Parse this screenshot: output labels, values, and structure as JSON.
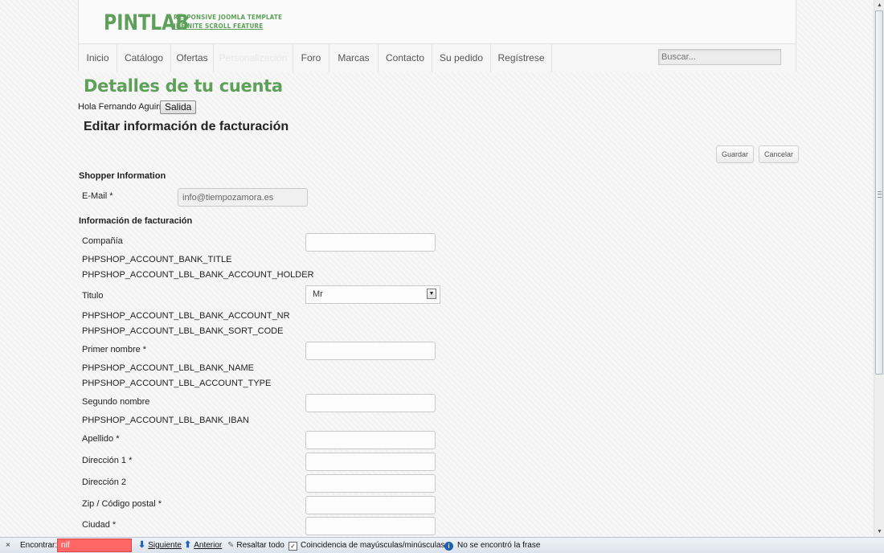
{
  "logo": {
    "text": "PINTLAB",
    "tagline_1": "RESPONSIVE JOOMLA TEMPLATE",
    "tagline_2": "INFINITE SCROLL FEATURE"
  },
  "nav": {
    "items": [
      {
        "label": "Inicio"
      },
      {
        "label": "Catálogo"
      },
      {
        "label": "Ofertas"
      },
      {
        "label": "Personalización"
      },
      {
        "label": "Foro"
      },
      {
        "label": "Marcas"
      },
      {
        "label": "Contacto"
      },
      {
        "label": "Su pedido"
      },
      {
        "label": "Regístrese"
      }
    ],
    "search_placeholder": "Buscar..."
  },
  "page": {
    "title": "Detalles de tu cuenta",
    "greeting": "Hola Fernando Aguirre",
    "logout_label": "Salida",
    "section_title": "Editar información de facturación",
    "save_label": "Guardar",
    "cancel_label": "Cancelar"
  },
  "shopper": {
    "group_title": "Shopper Information",
    "email_label": "E-Mail *",
    "email_value": "info@tiempozamora.es"
  },
  "billing": {
    "group_title": "Información de facturación",
    "company_label": "Compañía",
    "bank_title": "PHPSHOP_ACCOUNT_BANK_TITLE",
    "bank_holder": "PHPSHOP_ACCOUNT_LBL_BANK_ACCOUNT_HOLDER",
    "title_label": "Titulo",
    "title_value": "Mr",
    "bank_nr": "PHPSHOP_ACCOUNT_LBL_BANK_ACCOUNT_NR",
    "bank_sort": "PHPSHOP_ACCOUNT_LBL_BANK_SORT_CODE",
    "first_name_label": "Primer nombre *",
    "bank_name": "PHPSHOP_ACCOUNT_LBL_BANK_NAME",
    "account_type": "PHPSHOP_ACCOUNT_LBL_ACCOUNT_TYPE",
    "middle_name_label": "Segundo nombre",
    "bank_iban": "PHPSHOP_ACCOUNT_LBL_BANK_IBAN",
    "last_name_label": "Apellido *",
    "address1_label": "Dirección 1 *",
    "address2_label": "Dirección 2",
    "zip_label": "Zip / Código postal *",
    "city_label": "Ciudad *"
  },
  "findbar": {
    "close": "×",
    "label": "Encontrar:",
    "query": "nif",
    "next": "Siguiente",
    "prev": "Anterior",
    "highlight": "Resaltar todo",
    "match_case": "Coincidencia de mayúsculas/minúsculas",
    "status": "No se encontró la frase"
  },
  "colors": {
    "brand_green": "#5ea05a",
    "find_not_found": "#ff6666"
  }
}
